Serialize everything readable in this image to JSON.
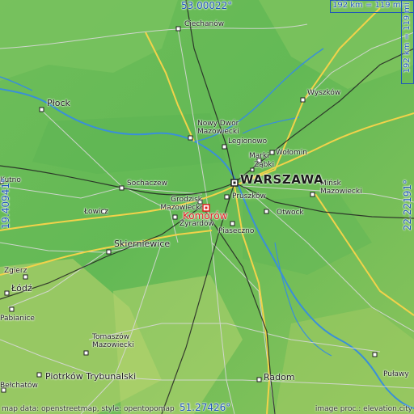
{
  "map": {
    "place_marker_label": "Komorów",
    "capital_label": "WARSZAWA",
    "cities": [
      {
        "id": "ciechanow",
        "label": "Ciechanów"
      },
      {
        "id": "plock",
        "label": "Płock"
      },
      {
        "id": "wyszkow",
        "label": "Wyszków"
      },
      {
        "id": "nowy-dwor",
        "label": "Nowy Dwór Mazowiecki"
      },
      {
        "id": "legionowo",
        "label": "Legionowo"
      },
      {
        "id": "marki",
        "label": "Marki"
      },
      {
        "id": "wolomin",
        "label": "Wołomin"
      },
      {
        "id": "zabki",
        "label": "Ząbki"
      },
      {
        "id": "sochaczew",
        "label": "Sochaczew"
      },
      {
        "id": "minsk",
        "label": "Mińsk Mazowiecki"
      },
      {
        "id": "pruszkow",
        "label": "Pruszków"
      },
      {
        "id": "grodzisk",
        "label": "Grodzisk Mazowiecki"
      },
      {
        "id": "lowicz",
        "label": "Łowicz"
      },
      {
        "id": "otwock",
        "label": "Otwock"
      },
      {
        "id": "zyrardow",
        "label": "Żyrardów"
      },
      {
        "id": "piaseczno",
        "label": "Piaseczno"
      },
      {
        "id": "skierniewice",
        "label": "Skierniewice"
      },
      {
        "id": "zgierz",
        "label": "Zgierz"
      },
      {
        "id": "lodz",
        "label": "Łódź"
      },
      {
        "id": "pabianice",
        "label": "Pabianice"
      },
      {
        "id": "tomaszow",
        "label": "Tomaszów Mazowiecki"
      },
      {
        "id": "piotrkow",
        "label": "Piotrków Trybunalski"
      },
      {
        "id": "radom",
        "label": "Radom"
      },
      {
        "id": "pulawy",
        "label": "Puławy"
      },
      {
        "id": "belchatow",
        "label": "Bełchatów"
      },
      {
        "id": "kutno",
        "label": "Kutno"
      }
    ],
    "coords": {
      "top_lat": "53.00022°",
      "bottom_lat": "51.27426°",
      "left_lon": "19.40941°",
      "right_lon": "22.22191°"
    },
    "scale": {
      "horizontal": "192 km = 119 mi",
      "vertical": "192 km = 119 mi"
    },
    "attribution_left": "map data: openstreetmap, style: opentopomap",
    "attribution_right": "image proc.: elevation.city"
  },
  "colors": {
    "lowland": "#6fbf5a",
    "upland": "#a8cf6a",
    "water": "#3a8fd8",
    "road_major": "#f2d24a",
    "road_minor": "#d8d8d8",
    "rail": "#222222",
    "coord_text": "#1f56b8",
    "marker": "#e02020"
  }
}
